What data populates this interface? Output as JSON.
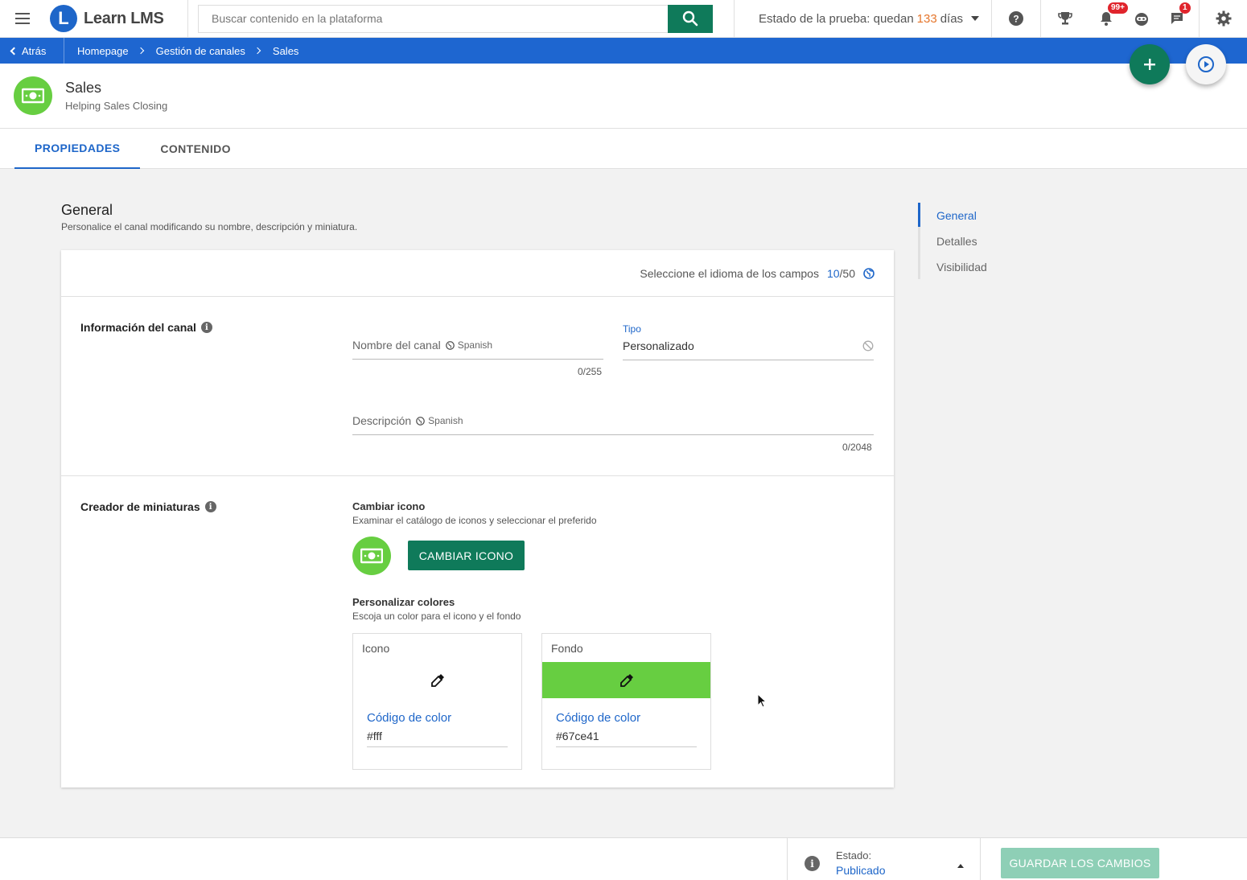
{
  "topbar": {
    "brand": "Learn LMS",
    "search_placeholder": "Buscar contenido en la plataforma",
    "trial_prefix": "Estado de la prueba: quedan",
    "trial_days": "133",
    "trial_suffix": "días",
    "notifications_badge": "99+",
    "messages_badge": "1"
  },
  "breadcrumb": {
    "back": "Atrás",
    "items": [
      "Homepage",
      "Gestión de canales",
      "Sales"
    ]
  },
  "channel": {
    "title": "Sales",
    "subtitle": "Helping Sales Closing",
    "icon_bg": "#67ce41"
  },
  "tabs": [
    "PROPIEDADES",
    "CONTENIDO"
  ],
  "general": {
    "title": "General",
    "subtitle": "Personalice el canal modificando su nombre, descripción y miniatura.",
    "lang_select": "Seleccione el idioma de los campos",
    "lang_count": "10",
    "lang_total": "/50"
  },
  "info": {
    "label": "Información del canal",
    "name_label": "Nombre del canal",
    "name_lang": "Spanish",
    "name_counter": "0/255",
    "tipo_label": "Tipo",
    "tipo_value": "Personalizado",
    "desc_label": "Descripción",
    "desc_lang": "Spanish",
    "desc_counter": "0/2048"
  },
  "thumbnail": {
    "label": "Creador de miniaturas",
    "change_icon_title": "Cambiar icono",
    "change_icon_sub": "Examinar el catálogo de iconos y seleccionar el preferido",
    "change_icon_button": "CAMBIAR ICONO",
    "colors_title": "Personalizar colores",
    "colors_sub": "Escoja un color para el icono y el fondo",
    "icon_box": {
      "title": "Icono",
      "code_label": "Código de color",
      "code": "#fff",
      "swatch": "#ffffff"
    },
    "bg_box": {
      "title": "Fondo",
      "code_label": "Código de color",
      "code": "#67ce41",
      "swatch": "#67ce41"
    }
  },
  "right_nav": [
    "General",
    "Detalles",
    "Visibilidad"
  ],
  "footer": {
    "status_label": "Estado:",
    "status_value": "Publicado",
    "save_button": "GUARDAR LOS CAMBIOS"
  }
}
